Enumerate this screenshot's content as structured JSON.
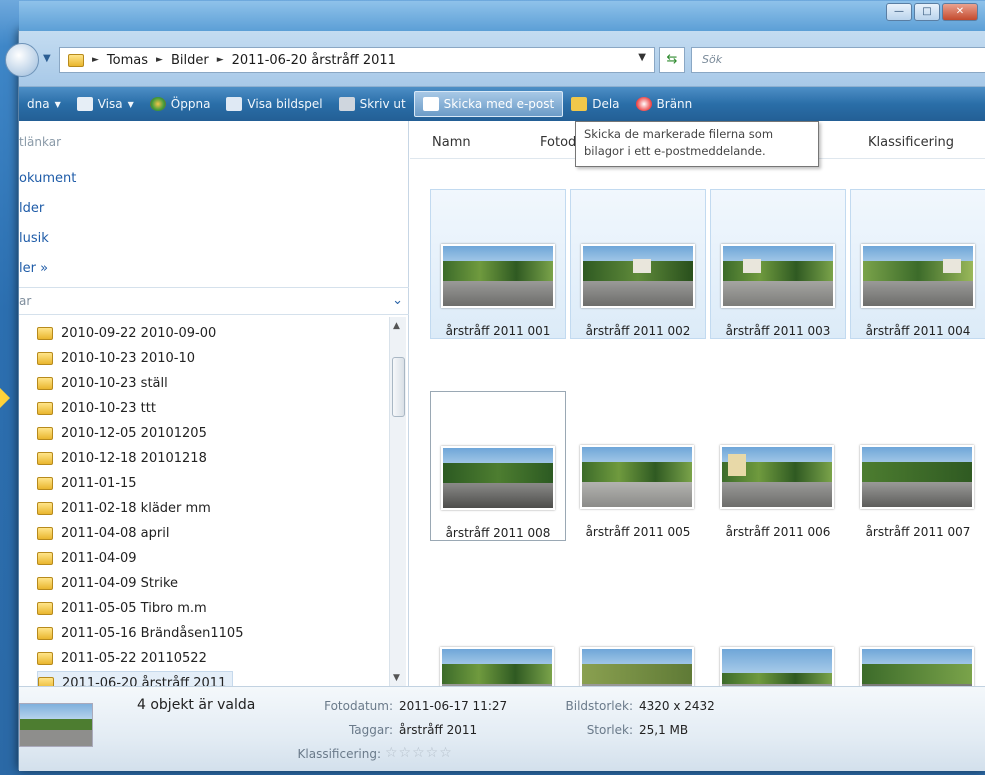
{
  "address": {
    "crumbs": [
      "Tomas",
      "Bilder",
      "2011-06-20 årstråff 2011"
    ],
    "search_placeholder": "Sök"
  },
  "toolbar": {
    "items": [
      {
        "label": "dna",
        "arrow": true,
        "icon": "organize-icon"
      },
      {
        "label": "Visa",
        "arrow": true,
        "icon": "views-icon"
      },
      {
        "label": "Öppna",
        "arrow": false,
        "icon": "open-icon"
      },
      {
        "label": "Visa bildspel",
        "arrow": false,
        "icon": "slideshow-icon"
      },
      {
        "label": "Skriv ut",
        "arrow": false,
        "icon": "print-icon"
      },
      {
        "label": "Skicka med e-post",
        "arrow": false,
        "icon": "email-icon",
        "highlight": true
      },
      {
        "label": "Dela",
        "arrow": false,
        "icon": "share-icon"
      },
      {
        "label": "Bränn",
        "arrow": false,
        "icon": "burn-icon"
      }
    ]
  },
  "favorites": {
    "header": "tlänkar",
    "links": [
      "okument",
      "lder",
      "lusik",
      "ler »"
    ]
  },
  "folders_header": "ar",
  "tree": [
    "2010-09-22 2010-09-00",
    "2010-10-23 2010-10",
    "2010-10-23 ställ",
    "2010-10-23 ttt",
    "2010-12-05 20101205",
    "2010-12-18 20101218",
    "2011-01-15",
    "2011-02-18 kläder mm",
    "2011-04-08 april",
    "2011-04-09",
    "2011-04-09 Strike",
    "2011-05-05 Tibro m.m",
    "2011-05-16 Brändåsen1105",
    "2011-05-22 20110522",
    "2011-06-20 årstråff 2011"
  ],
  "columns": {
    "name": "Namn",
    "date": "Fotodat",
    "rating": "Klassificering"
  },
  "tooltip": {
    "line1": "Skicka de markerade filerna som",
    "line2": "bilagor i ett e-postmeddelande."
  },
  "photos": [
    {
      "label": "årstråff 2011 001",
      "selected": true
    },
    {
      "label": "årstråff 2011 002",
      "selected": true
    },
    {
      "label": "årstråff 2011 003",
      "selected": true
    },
    {
      "label": "årstråff 2011 004",
      "selected": true
    },
    {
      "label": "årstråff 2011 008",
      "selected": false,
      "focused": true
    },
    {
      "label": "årstråff 2011 005",
      "selected": false
    },
    {
      "label": "årstråff 2011 006",
      "selected": false
    },
    {
      "label": "årstråff 2011 007",
      "selected": false
    },
    {
      "label": "",
      "selected": false
    },
    {
      "label": "",
      "selected": false
    },
    {
      "label": "",
      "selected": false
    },
    {
      "label": "",
      "selected": false
    }
  ],
  "details": {
    "count": "4 objekt är valda",
    "date_label": "Fotodatum:",
    "date_value": "2011-06-17 11:27",
    "tags_label": "Taggar:",
    "tags_value": "årstråff 2011",
    "rating_label": "Klassificering:",
    "size_label": "Bildstorlek:",
    "size_value": "4320 x 2432",
    "filesize_label": "Storlek:",
    "filesize_value": "25,1 MB",
    "stars": "☆☆☆☆☆"
  }
}
